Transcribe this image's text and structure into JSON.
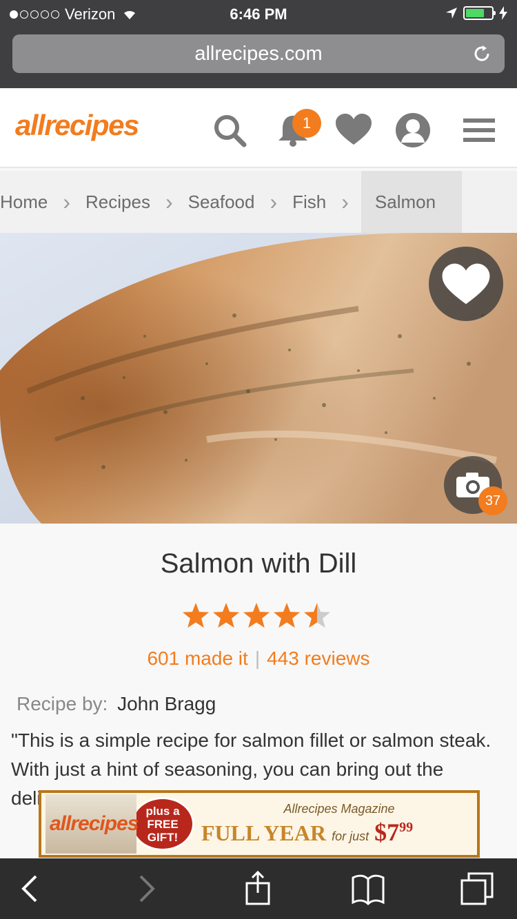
{
  "status_bar": {
    "carrier": "Verizon",
    "time": "6:46 PM",
    "signal_bars_filled": 1,
    "signal_bars_total": 5,
    "battery_level": 0.6
  },
  "browser": {
    "url": "allrecipes.com"
  },
  "site": {
    "logo": "allrecipes",
    "notification_count": "1",
    "icons": [
      "search-icon",
      "bell-icon",
      "heart-icon",
      "user-icon",
      "menu-icon"
    ]
  },
  "breadcrumb": [
    "Home",
    "Recipes",
    "Seafood",
    "Fish",
    "Salmon"
  ],
  "hero": {
    "photo_count": "37"
  },
  "recipe": {
    "title": "Salmon with Dill",
    "rating": 4.5,
    "rating_max": 5,
    "made_it": "601 made it",
    "reviews": "443 reviews",
    "byline_label": "Recipe by:",
    "author": "John Bragg",
    "description": "\"This is a simple recipe for salmon fillet or salmon steak. With just a hint of seasoning, you can bring out the delicate taste of the salmon to pair with a tart"
  },
  "ad": {
    "magazine_logo": "allrecipes",
    "gift_line1": "plus a",
    "gift_line2": "FREE",
    "gift_line3": "GIFT!",
    "magazine_name": "Allrecipes Magazine",
    "headline": "FULL YEAR",
    "for_just": "for just",
    "price": "$7",
    "price_cents": "99"
  },
  "colors": {
    "accent": "#f27c1e",
    "chrome": "#3f3f41",
    "toolbar": "#2d2d2d"
  }
}
